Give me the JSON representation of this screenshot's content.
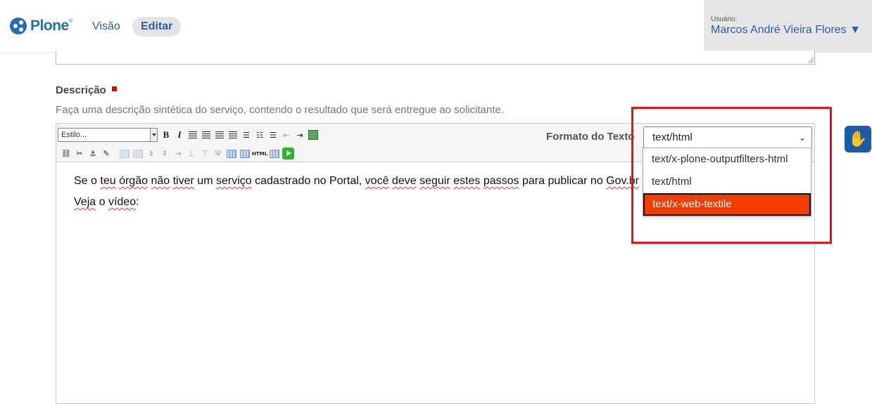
{
  "header": {
    "logo_text": "Plone",
    "logo_sup": "®",
    "nav": {
      "visao": "Visão",
      "editar": "Editar"
    },
    "user": {
      "label": "Usuário:",
      "name": "Marcos André Vieira Flores ▼"
    }
  },
  "field": {
    "label": "Descrição",
    "help": "Faça uma descrição sintética do serviço, contendo o resultado que será entregue ao solicitante."
  },
  "editor": {
    "style_select": "Estilo...",
    "bold": "B",
    "italic": "I",
    "html_button": "HTML",
    "format_label": "Formato do Texto",
    "format_value": "text/html",
    "content": {
      "line1": [
        "Se o",
        "teu",
        "órgão",
        "não",
        "tiver",
        "um",
        "serviço",
        "cadastrado no Portal,",
        "você",
        "deve",
        "seguir",
        "estes",
        "passos",
        "para publicar no",
        "Gov.br"
      ],
      "line2": [
        "Veja",
        "o",
        "vídeo",
        ":"
      ]
    }
  },
  "format_options": [
    {
      "label": "text/x-plone-outputfilters-html",
      "selected": false
    },
    {
      "label": "text/html",
      "selected": false
    },
    {
      "label": "text/x-web-textile",
      "selected": true
    }
  ],
  "colors": {
    "accent": "#1f6fb2",
    "highlight": "#f23c00",
    "annotation": "#ee1111"
  }
}
